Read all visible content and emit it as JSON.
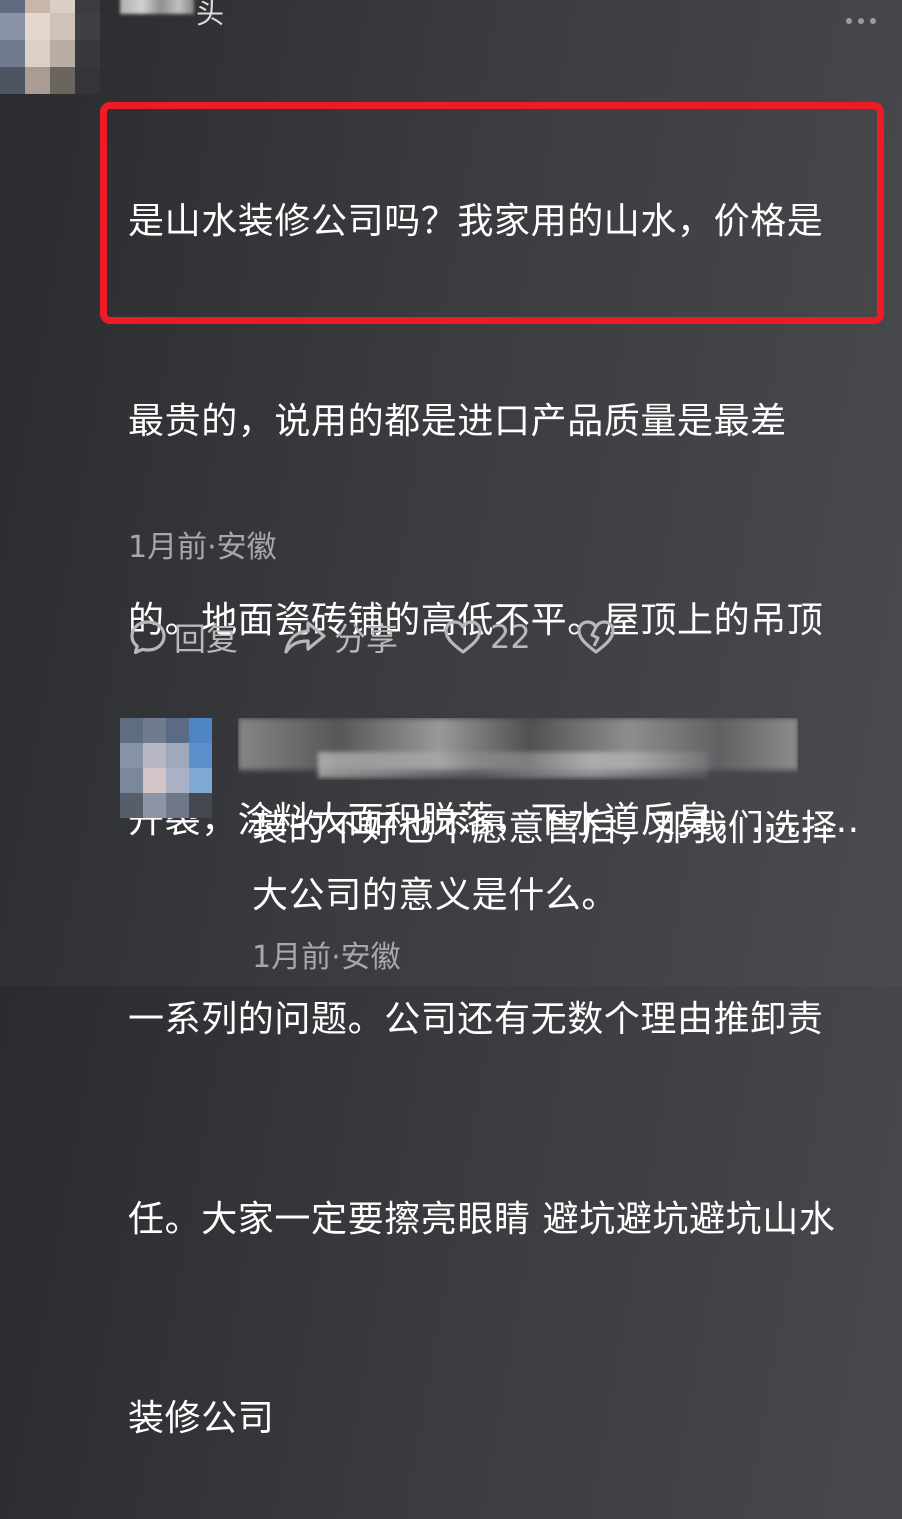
{
  "top_comment": {
    "username_tail": "头",
    "lines": [
      "是山水装修公司吗？我家用的山水，价格是",
      "最贵的，说用的都是进口产品质量是最差",
      "的。地面瓷砖铺的高低不平。屋顶上的吊顶",
      "开裂，涂料大面积脱落，下水道反臭，………",
      "一系列的问题。公司还有无数个理由推卸责",
      "任。大家一定要擦亮眼睛 避坑避坑避坑山水",
      "装修公司"
    ],
    "meta": "1月前·安徽",
    "actions": {
      "reply_label": "回复",
      "share_label": "分享",
      "like_count": "22"
    }
  },
  "reply": {
    "lines": [
      "装的不好也不愿意售后，那我们选择",
      "大公司的意义是什么。"
    ],
    "meta": "1月前·安徽"
  },
  "icons": {
    "more": "more-dots-icon",
    "reply": "comment-bubble-icon",
    "share": "share-arrow-icon",
    "like": "heart-icon",
    "dislike": "broken-heart-icon"
  },
  "colors": {
    "highlight": "#ee1b24",
    "text": "#ffffff",
    "meta": "#a8a8aa",
    "action": "#b8b8ba"
  }
}
